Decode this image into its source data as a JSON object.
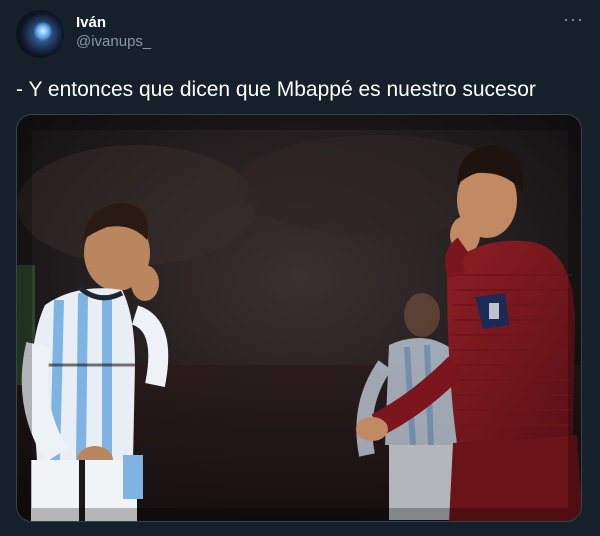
{
  "tweet": {
    "author": {
      "display_name": "Iván",
      "handle": "@ivanups_"
    },
    "more_label": "···",
    "text": "- Y entonces que dicen que Mbappé es nuestro sucesor"
  },
  "colors": {
    "background": "#15202b",
    "text_primary": "#ffffff",
    "text_secondary": "#8899a6",
    "border": "#38444d"
  },
  "icons": {
    "more": "more-options-icon"
  }
}
